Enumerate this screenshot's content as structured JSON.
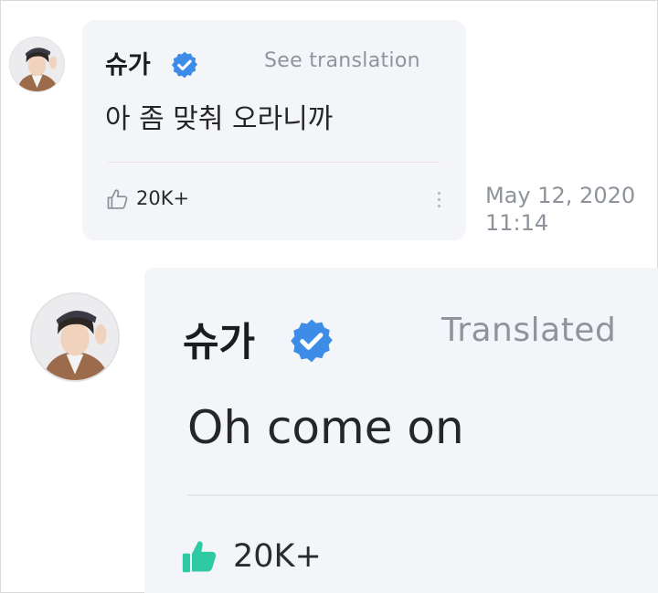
{
  "comment": {
    "author": "슈가",
    "see_translation_label": "See translation",
    "text": "아 좀 맞춰 오라니까",
    "likes": "20K+",
    "timestamp_date": "May 12, 2020",
    "timestamp_time": "11:14"
  },
  "translated": {
    "author": "슈가",
    "status_label": "Translated",
    "text": "Oh come on",
    "likes": "20K+"
  },
  "colors": {
    "bubble_bg": "#f4f5f8",
    "verified_badge": "#3d8de8",
    "like_active": "#2fc9a4",
    "muted_text": "#8e939b"
  },
  "icons": {
    "verified": "verified-badge-icon",
    "like_outline": "thumbs-up-outline-icon",
    "like_filled": "thumbs-up-filled-icon",
    "more": "more-vertical-icon"
  }
}
